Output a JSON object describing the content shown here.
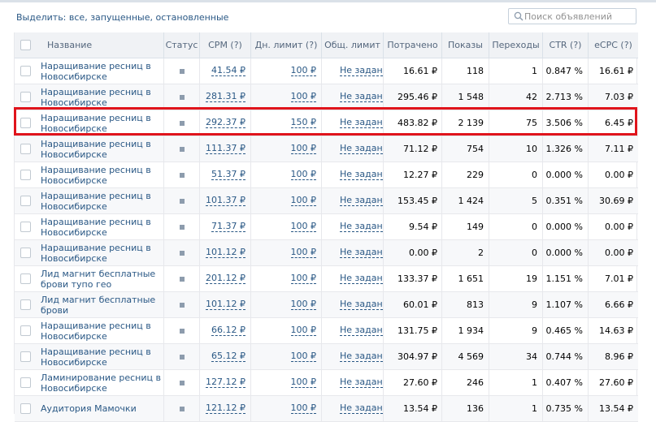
{
  "toolbar": {
    "select_label": "Выделить:",
    "select_all": "все",
    "select_running": "запущенные",
    "select_stopped": "остановленные",
    "search_placeholder": "Поиск объявлений"
  },
  "colors": {
    "link": "#2a5885",
    "header_bg": "#f0f2f5",
    "highlight": "#e0141c",
    "status_square": "#8d9cad"
  },
  "table": {
    "headers": {
      "name": "Название",
      "status": "Статус",
      "cpm": "CPM (?)",
      "day_limit": "Дн. лимит (?)",
      "total_limit": "Общ. лимит",
      "spent": "Потрачено",
      "shows": "Показы",
      "clicks": "Переходы",
      "ctr": "CTR (?)",
      "ecpc": "eCPC (?)"
    },
    "rows": [
      {
        "name": "Наращивание ресниц в Новосибирске",
        "cpm": "41.54 ₽",
        "day_limit": "100 ₽",
        "total_limit": "Не задан",
        "spent": "16.61 ₽",
        "shows": "118",
        "clicks": "1",
        "ctr": "0.847 %",
        "ecpc": "16.61 ₽"
      },
      {
        "name": "Наращивание ресниц в Новосибирске",
        "cpm": "281.31 ₽",
        "day_limit": "100 ₽",
        "total_limit": "Не задан",
        "spent": "295.46 ₽",
        "shows": "1 548",
        "clicks": "42",
        "ctr": "2.713 %",
        "ecpc": "7.03 ₽"
      },
      {
        "name": "Наращивание ресниц в Новосибирске",
        "cpm": "292.37 ₽",
        "day_limit": "150 ₽",
        "total_limit": "Не задан",
        "spent": "483.82 ₽",
        "shows": "2 139",
        "clicks": "75",
        "ctr": "3.506 %",
        "ecpc": "6.45 ₽"
      },
      {
        "name": "Наращивание ресниц в Новосибирске",
        "cpm": "111.37 ₽",
        "day_limit": "100 ₽",
        "total_limit": "Не задан",
        "spent": "71.12 ₽",
        "shows": "754",
        "clicks": "10",
        "ctr": "1.326 %",
        "ecpc": "7.11 ₽"
      },
      {
        "name": "Наращивание ресниц в Новосибирске",
        "cpm": "51.37 ₽",
        "day_limit": "100 ₽",
        "total_limit": "Не задан",
        "spent": "12.27 ₽",
        "shows": "229",
        "clicks": "0",
        "ctr": "0.000 %",
        "ecpc": "0.00 ₽"
      },
      {
        "name": "Наращивание ресниц в Новосибирске",
        "cpm": "101.37 ₽",
        "day_limit": "100 ₽",
        "total_limit": "Не задан",
        "spent": "153.45 ₽",
        "shows": "1 424",
        "clicks": "5",
        "ctr": "0.351 %",
        "ecpc": "30.69 ₽"
      },
      {
        "name": "Наращивание ресниц в Новосибирске",
        "cpm": "71.37 ₽",
        "day_limit": "100 ₽",
        "total_limit": "Не задан",
        "spent": "9.54 ₽",
        "shows": "149",
        "clicks": "0",
        "ctr": "0.000 %",
        "ecpc": "0.00 ₽"
      },
      {
        "name": "Наращивание ресниц в Новосибирске",
        "cpm": "101.12 ₽",
        "day_limit": "100 ₽",
        "total_limit": "Не задан",
        "spent": "0.00 ₽",
        "shows": "2",
        "clicks": "0",
        "ctr": "0.000 %",
        "ecpc": "0.00 ₽"
      },
      {
        "name": "Лид магнит бесплатные брови тупо гео",
        "cpm": "201.12 ₽",
        "day_limit": "100 ₽",
        "total_limit": "Не задан",
        "spent": "133.37 ₽",
        "shows": "1 651",
        "clicks": "19",
        "ctr": "1.151 %",
        "ecpc": "7.01 ₽"
      },
      {
        "name": "Лид магнит бесплатные брови",
        "cpm": "101.12 ₽",
        "day_limit": "100 ₽",
        "total_limit": "Не задан",
        "spent": "60.01 ₽",
        "shows": "813",
        "clicks": "9",
        "ctr": "1.107 %",
        "ecpc": "6.66 ₽"
      },
      {
        "name": "Наращивание ресниц в Новосибирске",
        "cpm": "66.12 ₽",
        "day_limit": "100 ₽",
        "total_limit": "Не задан",
        "spent": "131.75 ₽",
        "shows": "1 934",
        "clicks": "9",
        "ctr": "0.465 %",
        "ecpc": "14.63 ₽"
      },
      {
        "name": "Наращивание ресниц в Новосибирске",
        "cpm": "65.12 ₽",
        "day_limit": "100 ₽",
        "total_limit": "Не задан",
        "spent": "304.97 ₽",
        "shows": "4 569",
        "clicks": "34",
        "ctr": "0.744 %",
        "ecpc": "8.96 ₽"
      },
      {
        "name": "Ламинирование ресниц в Новосибирске",
        "cpm": "127.12 ₽",
        "day_limit": "100 ₽",
        "total_limit": "Не задан",
        "spent": "27.60 ₽",
        "shows": "246",
        "clicks": "1",
        "ctr": "0.407 %",
        "ecpc": "27.60 ₽"
      },
      {
        "name": "Аудитория Мамочки",
        "cpm": "121.12 ₽",
        "day_limit": "100 ₽",
        "total_limit": "Не задан",
        "spent": "13.54 ₽",
        "shows": "136",
        "clicks": "1",
        "ctr": "0.735 %",
        "ecpc": "13.54 ₽"
      }
    ]
  }
}
